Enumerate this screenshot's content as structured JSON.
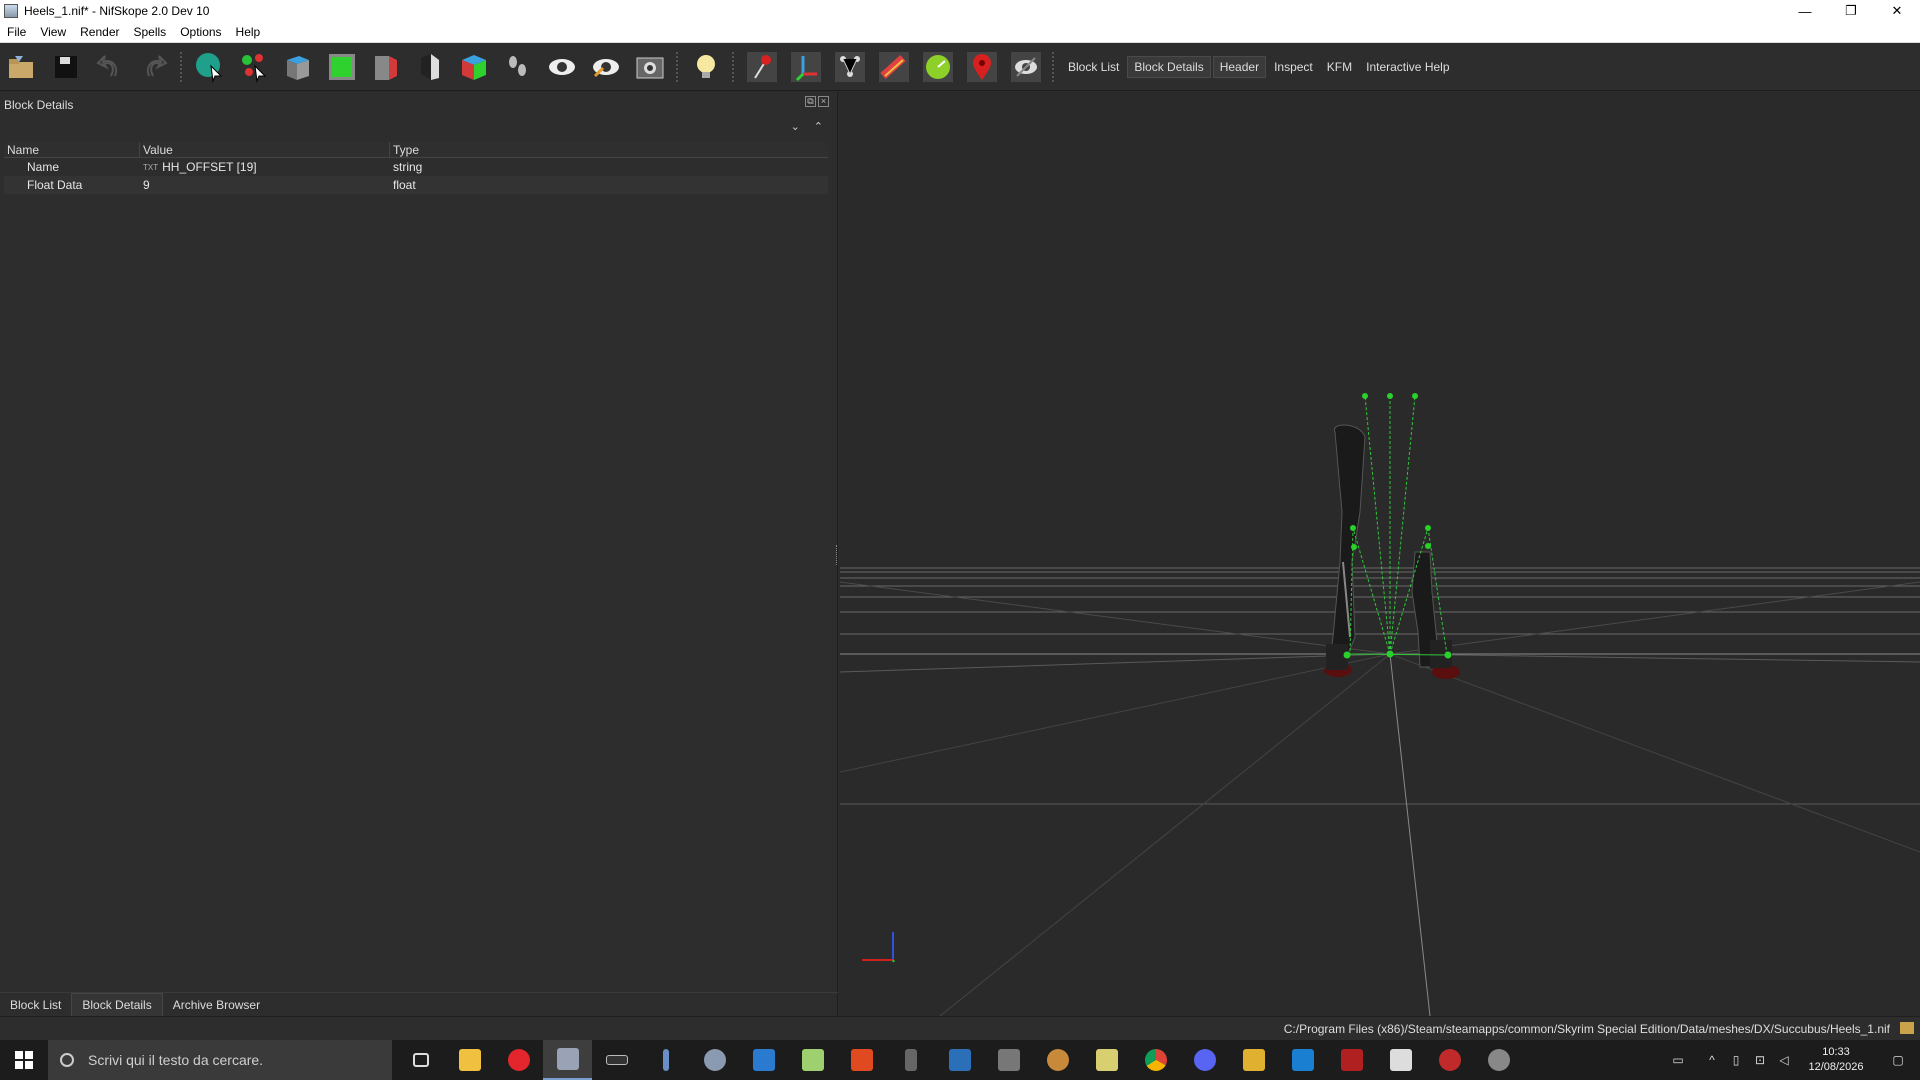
{
  "window": {
    "title": "Heels_1.nif* - NifSkope 2.0 Dev 10",
    "minimize": "—",
    "restore": "❐",
    "close": "✕"
  },
  "menu": [
    "File",
    "View",
    "Render",
    "Spells",
    "Options",
    "Help"
  ],
  "toolbar": {
    "links": [
      "Block List",
      "Block Details",
      "Header",
      "Inspect",
      "KFM",
      "Interactive Help"
    ],
    "active_link": "Block Details"
  },
  "dock": {
    "title": "Block Details",
    "columns": [
      "Name",
      "Value",
      "Type"
    ],
    "rows": [
      {
        "name": "Name",
        "value": "HH_OFFSET [19]",
        "type": "string",
        "value_icon": "TXT"
      },
      {
        "name": "Float Data",
        "value": "9",
        "type": "float"
      }
    ],
    "tabs": [
      "Block List",
      "Block Details",
      "Archive Browser"
    ],
    "active_tab": "Block Details"
  },
  "status": {
    "path": "C:/Program Files (x86)/Steam/steamapps/common/Skyrim Special Edition/Data/meshes/DX/Succubus/Heels_1.nif"
  },
  "taskbar": {
    "search_placeholder": "Scrivi qui il testo da cercare.",
    "time": "10:33",
    "date": "12/08/2026"
  },
  "colors": {
    "bg": "#2b2b2b",
    "bone": "#29d12a",
    "accent_red": "#d42020"
  }
}
